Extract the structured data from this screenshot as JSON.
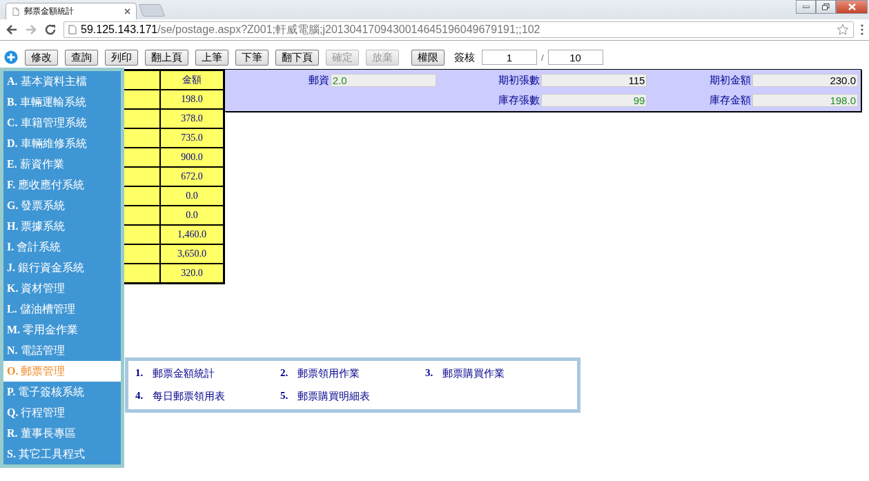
{
  "browser": {
    "tab_title": "郵票金額統計",
    "url_host": "59.125.143.171",
    "url_path": "/se/postage.aspx?Z001;軒威電腦;j2013041709430014645196049679191;;102"
  },
  "toolbar": {
    "buttons": [
      {
        "label": "修改",
        "disabled": false
      },
      {
        "label": "查詢",
        "disabled": false
      },
      {
        "label": "列印",
        "disabled": false
      },
      {
        "label": "翻上頁",
        "disabled": false
      },
      {
        "label": "上筆",
        "disabled": false
      },
      {
        "label": "下筆",
        "disabled": false
      },
      {
        "label": "翻下頁",
        "disabled": false
      },
      {
        "label": "確定",
        "disabled": true
      },
      {
        "label": "放棄",
        "disabled": true
      },
      {
        "label": "權限",
        "disabled": false
      }
    ],
    "sign_label": "簽核",
    "page_current": "1",
    "page_separator": "/",
    "page_total": "10"
  },
  "table": {
    "columns": [
      "金額"
    ],
    "rows": [
      "198.0",
      "378.0",
      "735.0",
      "900.0",
      "672.0",
      "0.0",
      "0.0",
      "1,460.0",
      "3,650.0",
      "320.0"
    ]
  },
  "form": {
    "rows": [
      {
        "fields": [
          {
            "label": "郵資",
            "value": "2.0",
            "computed": true,
            "kind": "left"
          },
          {
            "label": "期初張數",
            "value": "115",
            "computed": false,
            "kind": "right"
          },
          {
            "label": "期初金額",
            "value": "230.0",
            "computed": false,
            "kind": "right"
          }
        ]
      },
      {
        "fields": [
          {
            "label": "庫存張數",
            "value": "99",
            "computed": true,
            "kind": "right"
          },
          {
            "label": "庫存金額",
            "value": "198.0",
            "computed": true,
            "kind": "right"
          }
        ]
      }
    ]
  },
  "sidebar": {
    "items": [
      {
        "letter": "A.",
        "label": "基本資料主檔",
        "selected": false
      },
      {
        "letter": "B.",
        "label": "車輛運輸系統",
        "selected": false
      },
      {
        "letter": "C.",
        "label": "車籍管理系統",
        "selected": false
      },
      {
        "letter": "D.",
        "label": "車輛維修系統",
        "selected": false
      },
      {
        "letter": "E.",
        "label": "薪資作業",
        "selected": false
      },
      {
        "letter": "F.",
        "label": "應收應付系統",
        "selected": false
      },
      {
        "letter": "G.",
        "label": "發票系統",
        "selected": false
      },
      {
        "letter": "H.",
        "label": "票據系統",
        "selected": false
      },
      {
        "letter": "I.",
        "label": "會計系統",
        "selected": false
      },
      {
        "letter": "J.",
        "label": "銀行資金系統",
        "selected": false
      },
      {
        "letter": "K.",
        "label": "資材管理",
        "selected": false
      },
      {
        "letter": "L.",
        "label": "儲油槽管理",
        "selected": false
      },
      {
        "letter": "M.",
        "label": "零用金作業",
        "selected": false
      },
      {
        "letter": "N.",
        "label": "電話管理",
        "selected": false
      },
      {
        "letter": "O.",
        "label": "郵票管理",
        "selected": true
      },
      {
        "letter": "P.",
        "label": "電子簽核系統",
        "selected": false
      },
      {
        "letter": "Q.",
        "label": "行程管理",
        "selected": false
      },
      {
        "letter": "R.",
        "label": "董事長專區",
        "selected": false
      },
      {
        "letter": "S.",
        "label": "其它工具程式",
        "selected": false
      }
    ]
  },
  "submenu": {
    "items": [
      {
        "number": "1.",
        "label": "郵票金額統計"
      },
      {
        "number": "2.",
        "label": "郵票領用作業"
      },
      {
        "number": "3.",
        "label": "郵票購買作業"
      },
      {
        "number": "4.",
        "label": "每日郵票領用表"
      },
      {
        "number": "5.",
        "label": "郵票購買明細表"
      }
    ]
  }
}
